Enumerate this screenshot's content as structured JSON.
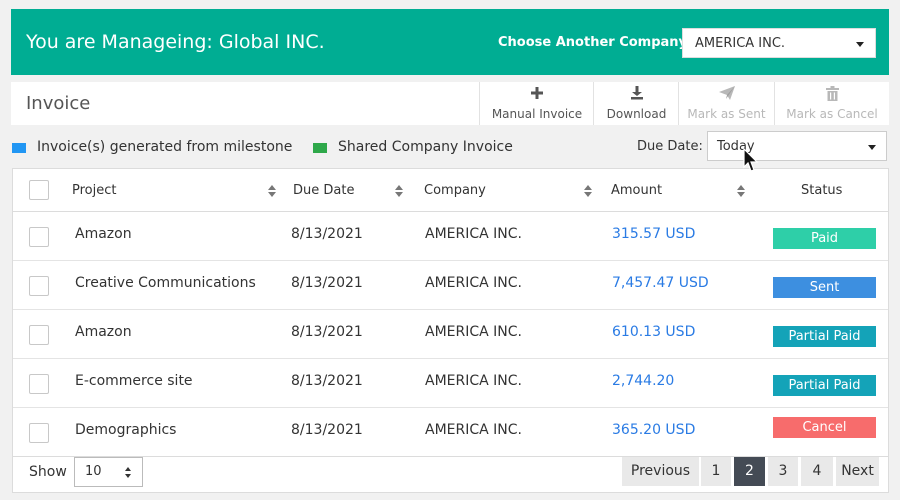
{
  "header": {
    "title": "You are Manageing: Global INC.",
    "choose_label": "Choose Another Company:",
    "company_value": "AMERICA INC."
  },
  "toolbar": {
    "page_title": "Invoice",
    "buttons": [
      {
        "label": "Manual Invoice",
        "icon": "plus-icon",
        "enabled": true
      },
      {
        "label": "Download",
        "icon": "download-icon",
        "enabled": true
      },
      {
        "label": "Mark as Sent",
        "icon": "paper-plane-icon",
        "enabled": false
      },
      {
        "label": "Mark as Cancel",
        "icon": "trash-icon",
        "enabled": false
      }
    ]
  },
  "legend": [
    {
      "label": "Invoice(s) generated from milestone",
      "color": "#2196f3"
    },
    {
      "label": "Shared Company Invoice",
      "color": "#2ea84a"
    }
  ],
  "filter": {
    "due_date_label": "Due Date:",
    "due_date_value": "Today"
  },
  "table": {
    "columns": [
      "Project",
      "Due Date",
      "Company",
      "Amount",
      "Status"
    ],
    "rows": [
      {
        "project": "Amazon",
        "due": "8/13/2021",
        "company": "AMERICA INC.",
        "amount": "315.57 USD",
        "status": "Paid",
        "status_color": "#2ecfa8"
      },
      {
        "project": "Creative Communications",
        "due": "8/13/2021",
        "company": "AMERICA INC.",
        "amount": "7,457.47 USD",
        "status": "Sent",
        "status_color": "#3d8fe0"
      },
      {
        "project": "Amazon",
        "due": "8/13/2021",
        "company": "AMERICA INC.",
        "amount": "610.13 USD",
        "status": "Partial Paid",
        "status_color": "#14a3b8"
      },
      {
        "project": "E-commerce site",
        "due": "8/13/2021",
        "company": "AMERICA INC.",
        "amount": "2,744.20",
        "status": "Partial Paid",
        "status_color": "#14a3b8"
      },
      {
        "project": "Demographics",
        "due": "8/13/2021",
        "company": "AMERICA INC.",
        "amount": "365.20 USD",
        "status": "Cancel",
        "status_color": "#f76c6c"
      }
    ]
  },
  "pagination": {
    "show_label": "Show",
    "page_size": "10",
    "previous": "Previous",
    "pages": [
      "1",
      "2",
      "3",
      "4"
    ],
    "current_page": "2",
    "next": "Next"
  }
}
